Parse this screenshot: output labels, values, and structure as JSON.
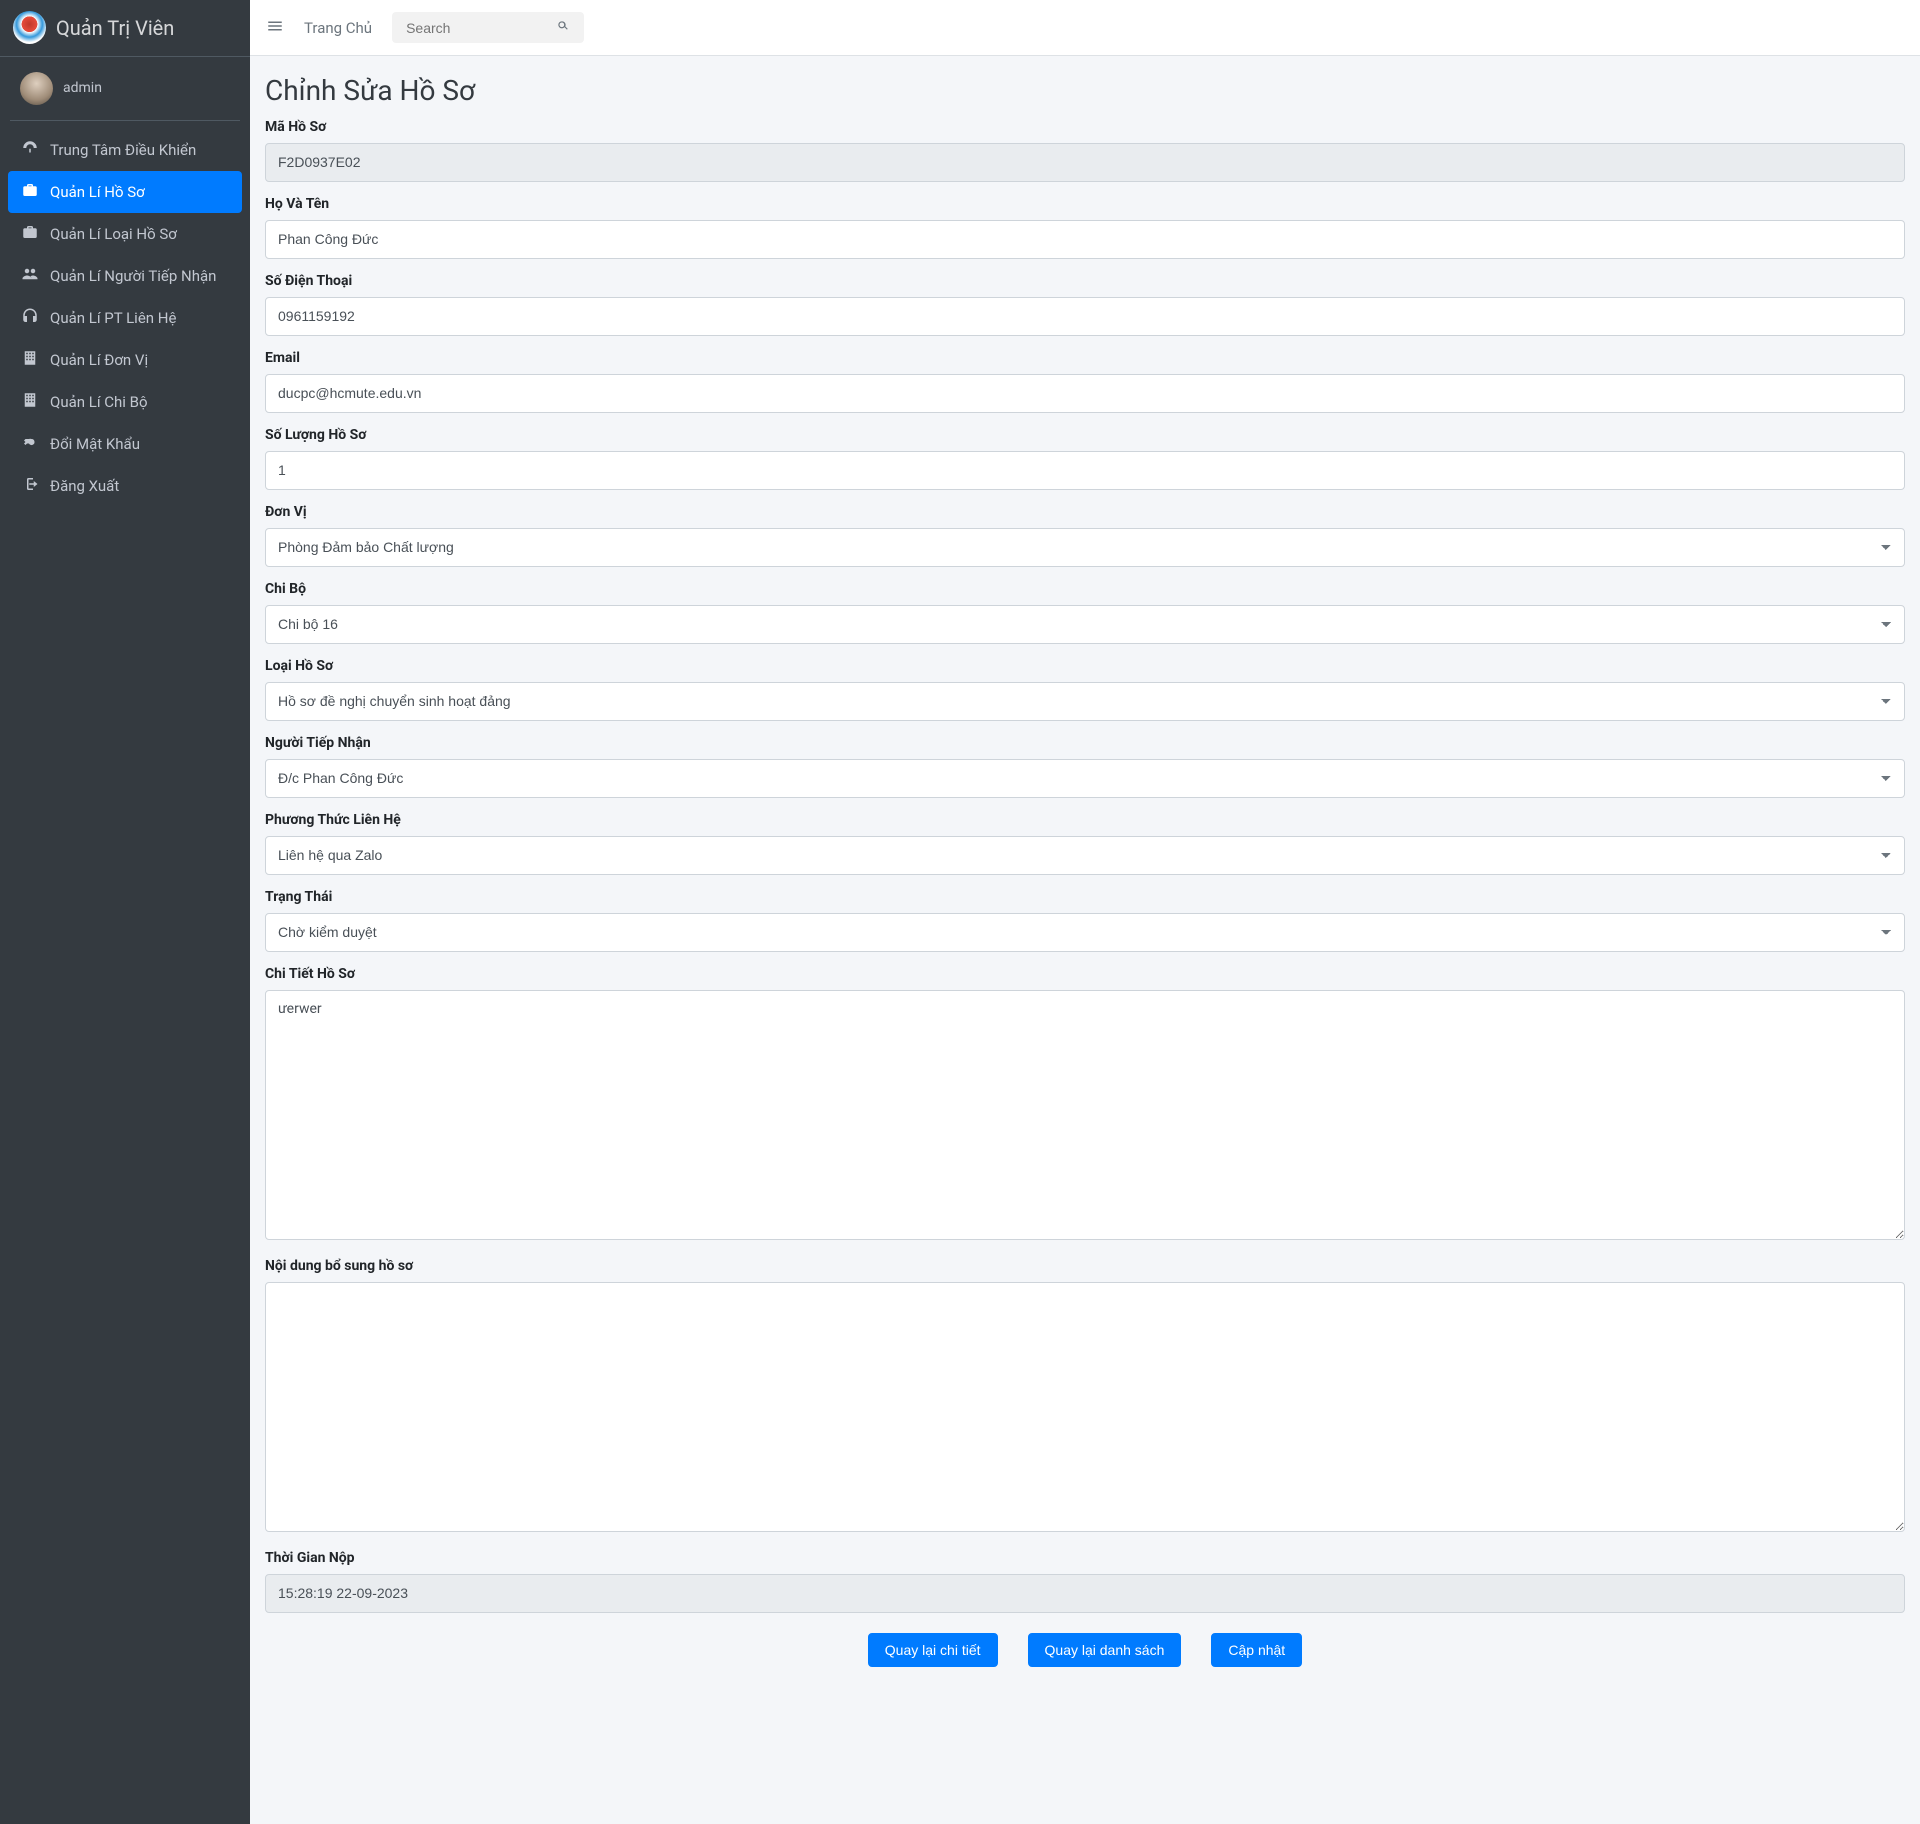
{
  "brand": {
    "title": "Quản Trị Viên"
  },
  "user": {
    "name": "admin"
  },
  "sidebar": {
    "items": [
      {
        "label": "Trung Tâm Điều Khiển",
        "icon": "dashboard-icon",
        "active": false
      },
      {
        "label": "Quản Lí Hồ Sơ",
        "icon": "briefcase-icon",
        "active": true
      },
      {
        "label": "Quản Lí Loại Hồ Sơ",
        "icon": "briefcase-icon",
        "active": false
      },
      {
        "label": "Quản Lí Người Tiếp Nhận",
        "icon": "users-icon",
        "active": false
      },
      {
        "label": "Quản Lí PT Liên Hệ",
        "icon": "headset-icon",
        "active": false
      },
      {
        "label": "Quản Lí Đơn Vị",
        "icon": "building-icon",
        "active": false
      },
      {
        "label": "Quản Lí Chi Bộ",
        "icon": "building-icon",
        "active": false
      },
      {
        "label": "Đổi Mật Khẩu",
        "icon": "key-icon",
        "active": false
      },
      {
        "label": "Đăng Xuất",
        "icon": "signout-icon",
        "active": false
      }
    ]
  },
  "topbar": {
    "home_label": "Trang Chủ",
    "search_placeholder": "Search"
  },
  "page": {
    "title": "Chỉnh Sửa Hồ Sơ"
  },
  "form": {
    "labels": {
      "ma_ho_so": "Mã Hồ Sơ",
      "ho_va_ten": "Họ Và Tên",
      "so_dien_thoai": "Số Điện Thoại",
      "email": "Email",
      "so_luong": "Số Lượng Hồ Sơ",
      "don_vi": "Đơn Vị",
      "chi_bo": "Chi Bộ",
      "loai_ho_so": "Loại Hồ Sơ",
      "nguoi_tiep_nhan": "Người Tiếp Nhận",
      "phuong_thuc_lien_he": "Phương Thức Liên Hệ",
      "trang_thai": "Trạng Thái",
      "chi_tiet": "Chi Tiết Hồ Sơ",
      "noi_dung_bo_sung": "Nội dung bổ sung hồ sơ",
      "thoi_gian_nop": "Thời Gian Nộp"
    },
    "values": {
      "ma_ho_so": "F2D0937E02",
      "ho_va_ten": "Phan Công Đức",
      "so_dien_thoai": "0961159192",
      "email": "ducpc@hcmute.edu.vn",
      "so_luong": "1",
      "don_vi": "Phòng Đảm bảo Chất lượng",
      "chi_bo": "Chi bộ 16",
      "loai_ho_so": "Hồ sơ đề nghị chuyển sinh hoạt đảng",
      "nguoi_tiep_nhan": "Đ/c Phan Công Đức",
      "phuong_thuc_lien_he": "Liên hệ qua Zalo",
      "trang_thai": "Chờ kiểm duyệt",
      "chi_tiet": "ưerwer",
      "noi_dung_bo_sung": "",
      "thoi_gian_nop": "15:28:19 22-09-2023"
    }
  },
  "buttons": {
    "back_detail": "Quay lại chi tiết",
    "back_list": "Quay lại danh sách",
    "update": "Cập nhật"
  }
}
